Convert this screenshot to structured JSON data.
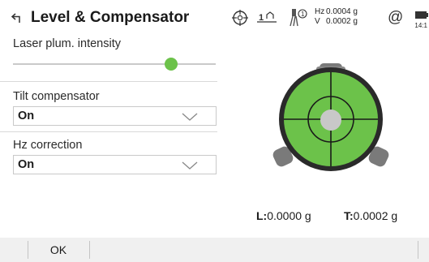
{
  "header": {
    "title": "Level & Compensator",
    "back_icon": "back-arrow-icon",
    "hz_label": "Hz",
    "hz_value": "0.0004 g",
    "v_label": "V",
    "v_value": "0.0002 g",
    "face_indicator": "1",
    "prism_indicator": "1",
    "clock": "14:1",
    "icons": [
      "target-icon",
      "face-indicator-icon",
      "prism-icon",
      "at-icon",
      "battery-icon"
    ]
  },
  "settings": {
    "laser_label": "Laser plum. intensity",
    "laser_intensity_fraction": 0.78,
    "tilt_label": "Tilt compensator",
    "tilt_value": "On",
    "hz_corr_label": "Hz correction",
    "hz_corr_value": "On"
  },
  "level": {
    "l_label": "L:",
    "l_value": "0.0000 g",
    "t_label": "T:",
    "t_value": "0.0002 g",
    "colors": {
      "bubble_green": "#6cc24a",
      "ring": "#2a2a2a",
      "bubble": "#c8c8c8"
    }
  },
  "bottom_bar": {
    "ok_label": "OK"
  },
  "colors": {
    "accent_green": "#6cc24a",
    "bar_bg": "#f0f0f0"
  }
}
